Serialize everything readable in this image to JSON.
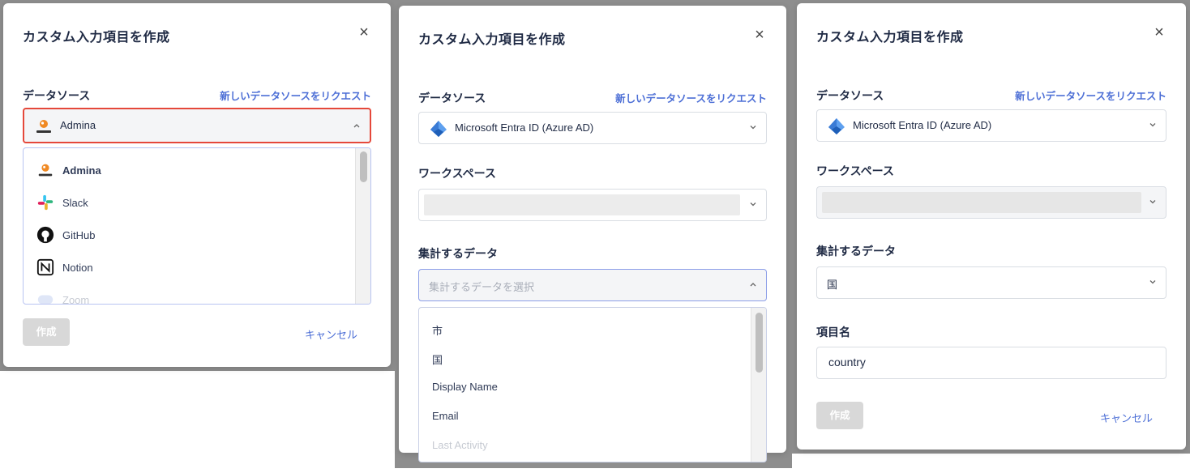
{
  "modal_title": "カスタム入力項目を作成",
  "close_symbol": "×",
  "labels": {
    "data_source": "データソース",
    "workspace": "ワークスペース",
    "aggregate_data": "集計するデータ",
    "item_name": "項目名"
  },
  "request_link": "新しいデータソースをリクエスト",
  "panel1": {
    "selected_source": "Admina",
    "selected_icon": "admina-logo-icon",
    "options": [
      {
        "label": "Admina",
        "icon": "admina-logo-icon"
      },
      {
        "label": "Slack",
        "icon": "slack-icon"
      },
      {
        "label": "GitHub",
        "icon": "github-icon"
      },
      {
        "label": "Notion",
        "icon": "notion-icon"
      },
      {
        "label": "Zoom",
        "icon": "zoom-icon"
      }
    ],
    "create_button": "作成",
    "cancel_button": "キャンセル"
  },
  "panel2": {
    "selected_source": "Microsoft Entra ID (Azure AD)",
    "aggregate_placeholder": "集計するデータを選択",
    "options": [
      "市",
      "国",
      "Display Name",
      "Email",
      "Last Activity"
    ]
  },
  "panel3": {
    "selected_source": "Microsoft Entra ID (Azure AD)",
    "aggregate_value": "国",
    "item_name_value": "country",
    "create_button": "作成",
    "cancel_button": "キャンセル"
  },
  "colors": {
    "accent": "#4d6fd6",
    "highlight_border": "#e5483a",
    "disabled_button": "#d8d8d8",
    "backdrop": "#8e8e8e"
  }
}
